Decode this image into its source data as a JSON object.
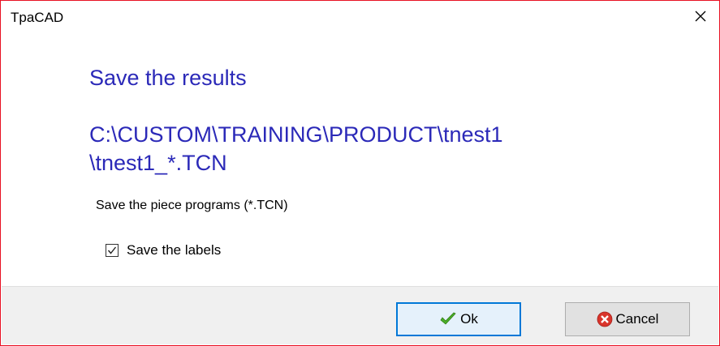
{
  "window": {
    "title": "TpaCAD",
    "close_icon": "close-icon"
  },
  "content": {
    "heading": "Save the results",
    "path_line1": "C:\\CUSTOM\\TRAINING\\PRODUCT\\tnest1",
    "path_line2": "\\tnest1_*.TCN",
    "description": "Save the piece programs (*.TCN)",
    "save_labels": {
      "label": "Save the labels",
      "checked": true
    }
  },
  "buttons": {
    "ok_label": "Ok",
    "ok_icon": "checkmark-icon",
    "cancel_label": "Cancel",
    "cancel_icon": "cancel-icon"
  },
  "colors": {
    "accent_text": "#2b29b8",
    "window_border": "#e81123",
    "default_button_border": "#0078d7",
    "cancel_icon": "#d9342b",
    "ok_icon": "#4caf28"
  }
}
